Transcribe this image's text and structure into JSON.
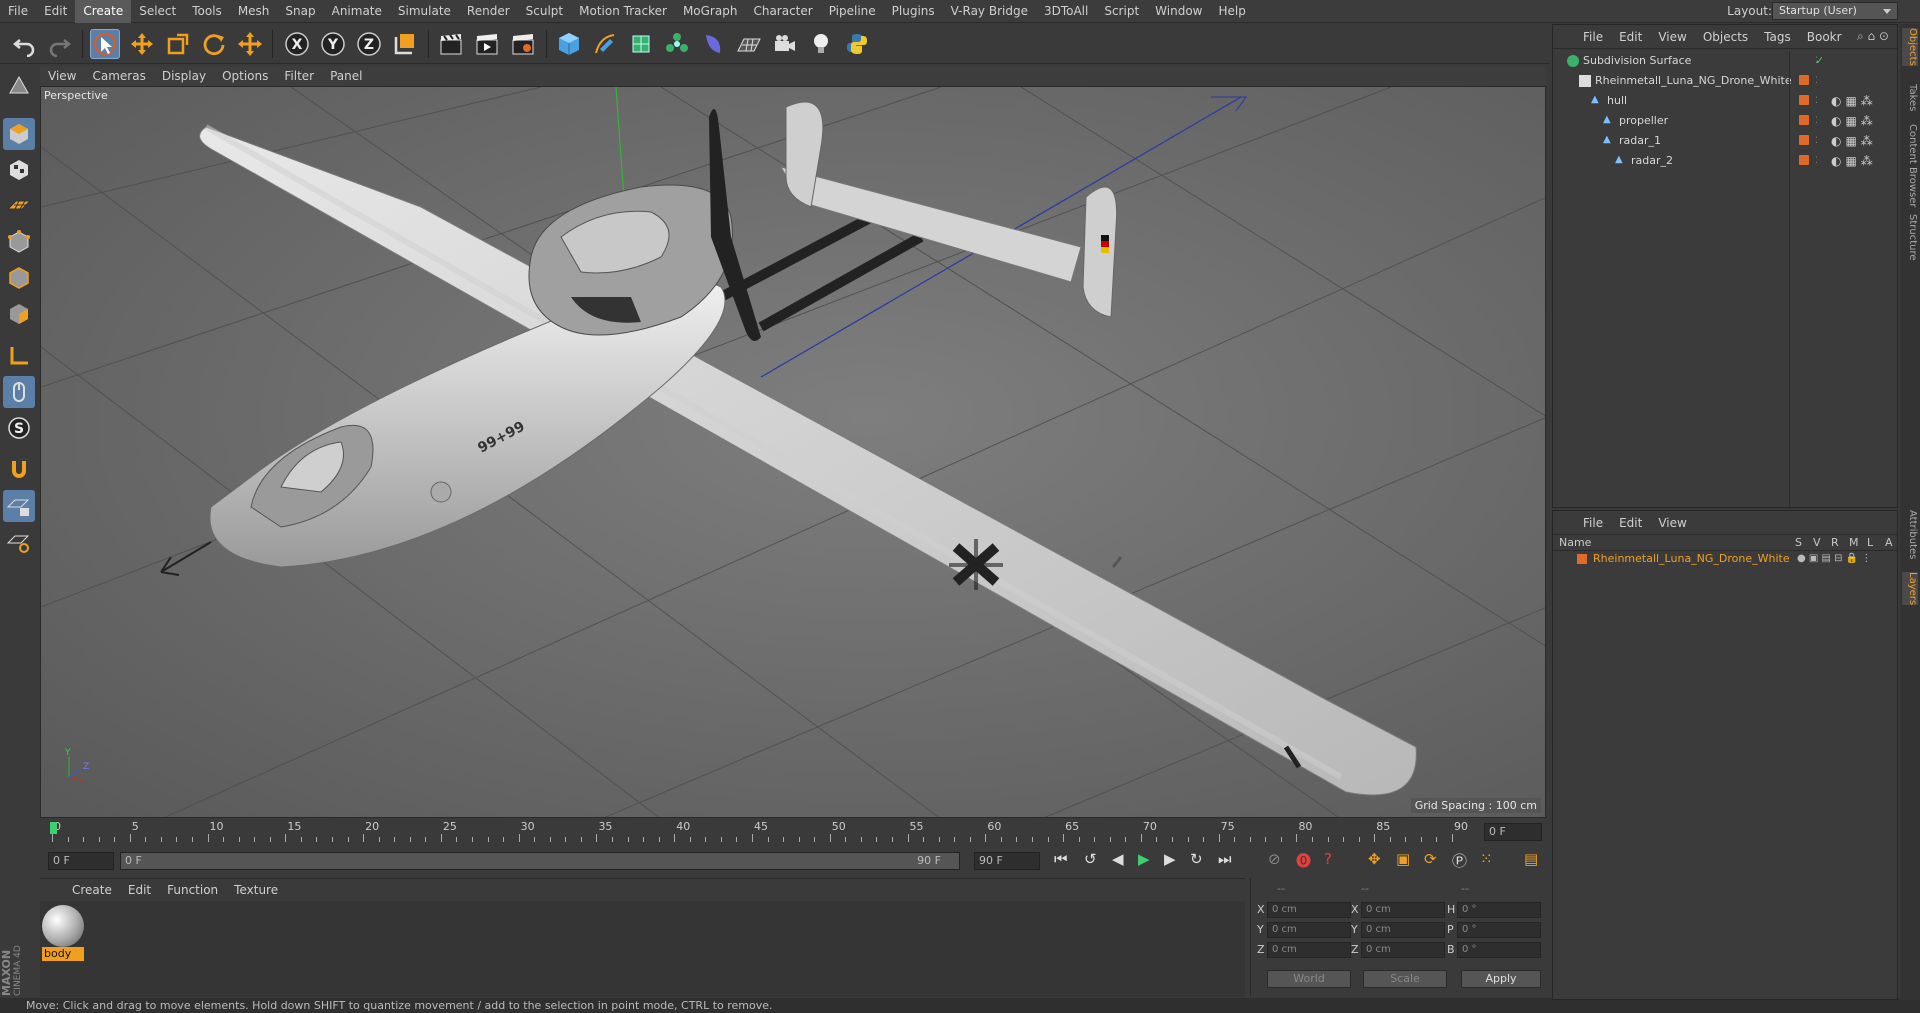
{
  "menubar": {
    "items": [
      "File",
      "Edit",
      "Create",
      "Select",
      "Tools",
      "Mesh",
      "Snap",
      "Animate",
      "Simulate",
      "Render",
      "Sculpt",
      "Motion Tracker",
      "MoGraph",
      "Character",
      "Pipeline",
      "Plugins",
      "V-Ray Bridge",
      "3DToAll",
      "Script",
      "Window",
      "Help"
    ],
    "active": "Create",
    "layout_label": "Layout:",
    "layout_value": "Startup (User)"
  },
  "viewport": {
    "menu": [
      "View",
      "Cameras",
      "Display",
      "Options",
      "Filter",
      "Panel"
    ],
    "title": "Perspective",
    "grid_spacing": "Grid Spacing : 100 cm"
  },
  "timeline": {
    "ticks": [
      "0",
      "5",
      "10",
      "15",
      "20",
      "25",
      "30",
      "35",
      "40",
      "45",
      "50",
      "55",
      "60",
      "65",
      "70",
      "75",
      "80",
      "85",
      "90"
    ],
    "current_frame": "0 F",
    "start_field": "0 F",
    "range_start": "0 F",
    "range_end": "90 F",
    "end_field": "90 F"
  },
  "materials": {
    "menu": [
      "Create",
      "Edit",
      "Function",
      "Texture"
    ],
    "items": [
      {
        "name": "body"
      }
    ]
  },
  "coords": {
    "header_a": "--",
    "header_b": "--",
    "header_c": "--",
    "rows": [
      {
        "l1": "X",
        "v1": "0 cm",
        "l2": "X",
        "v2": "0 cm",
        "l3": "H",
        "v3": "0 °"
      },
      {
        "l1": "Y",
        "v1": "0 cm",
        "l2": "Y",
        "v2": "0 cm",
        "l3": "P",
        "v3": "0 °"
      },
      {
        "l1": "Z",
        "v1": "0 cm",
        "l2": "Z",
        "v2": "0 cm",
        "l3": "B",
        "v3": "0 °"
      }
    ],
    "world": "World",
    "scale": "Scale",
    "apply": "Apply"
  },
  "status": "Move: Click and drag to move elements. Hold down SHIFT to quantize movement / add to the selection in point mode, CTRL to remove.",
  "objects": {
    "menu": [
      "File",
      "Edit",
      "View",
      "Objects",
      "Tags",
      "Bookr"
    ],
    "items": [
      {
        "name": "Subdivision Surface",
        "depth": 0
      },
      {
        "name": "Rheinmetall_Luna_NG_Drone_White",
        "depth": 1
      },
      {
        "name": "hull",
        "depth": 2
      },
      {
        "name": "propeller",
        "depth": 3
      },
      {
        "name": "radar_1",
        "depth": 3
      },
      {
        "name": "radar_2",
        "depth": 4
      }
    ]
  },
  "layers": {
    "menu": [
      "File",
      "Edit",
      "View"
    ],
    "col_name": "Name",
    "cols": [
      "S",
      "V",
      "R",
      "M",
      "L",
      "A"
    ],
    "row_name": "Rheinmetall_Luna_NG_Drone_White"
  },
  "sidetabs": [
    "Objects",
    "Takes",
    "Content Browser",
    "Structure",
    "Attributes",
    "Layers"
  ],
  "brand": {
    "a": "MAXON",
    "b": "CINEMA 4D"
  }
}
